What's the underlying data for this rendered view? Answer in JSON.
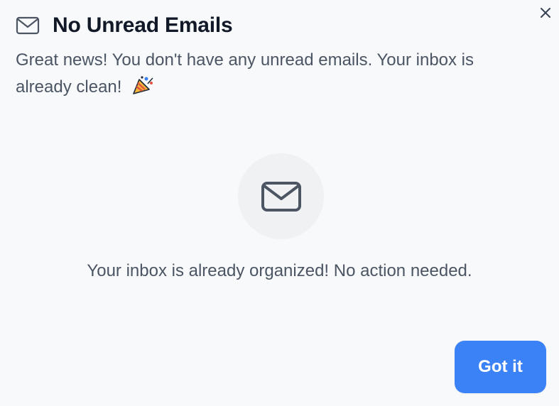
{
  "dialog": {
    "title": "No Unread Emails",
    "title_icon": "mail-icon",
    "close_icon": "close-icon",
    "message": "Great news! You don't have any unread emails. Your inbox is already clean!",
    "message_emoji_icon": "party-popper-icon",
    "empty_state": {
      "icon": "mail-icon",
      "text": "Your inbox is already organized! No action needed."
    },
    "primary_button_label": "Got it"
  },
  "colors": {
    "background": "#f8f9fb",
    "primary": "#3b82f6",
    "title_text": "#111827",
    "body_text": "#4b5563",
    "icon": "#4b5563",
    "empty_state_circle": "#f0f1f3"
  }
}
